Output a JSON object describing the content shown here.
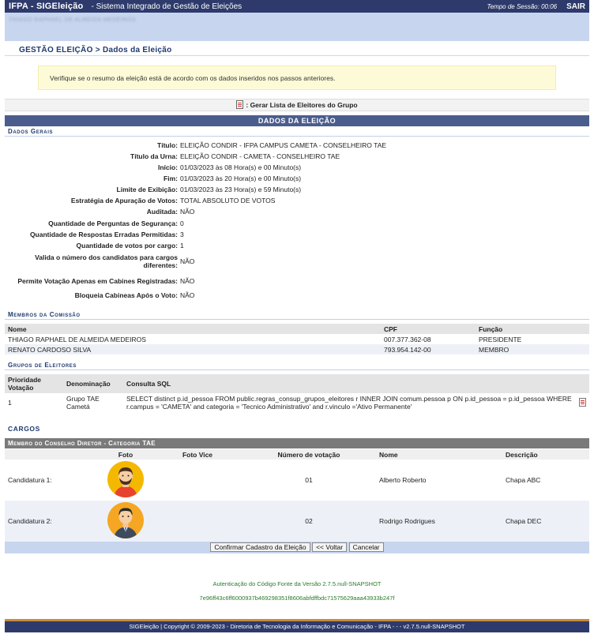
{
  "topbar": {
    "brand": "IFPA - SIGEleição",
    "subtitle": "- Sistema Integrado de Gestão de Eleições",
    "session": "Tempo de Sessão: 00:06",
    "logout": "SAIR"
  },
  "userbar": {
    "user_blurred": "THIAGO RAPHAEL DE ALMEIDA MEDEIROS"
  },
  "breadcrumb": "GESTÃO ELEIÇÃO > Dados da Eleição",
  "notice": "Verifique se o resumo da eleição está de acordo com os dados inseridos nos passos anteriores.",
  "gerar_lista": ": Gerar Lista de Eleitores do Grupo",
  "section_title": "DADOS DA ELEIÇÃO",
  "dados_gerais": {
    "heading": "Dados Gerais",
    "fields": [
      {
        "label": "Título:",
        "value": "ELEIÇÃO CONDIR - IFPA CAMPUS CAMETA - CONSELHEIRO TAE"
      },
      {
        "label": "Título da Urna:",
        "value": "ELEIÇÃO CONDIR - CAMETA - CONSELHEIRO TAE"
      },
      {
        "label": "Início:",
        "value": "01/03/2023 às 08 Hora(s) e 00 Minuto(s)"
      },
      {
        "label": "Fim:",
        "value": "01/03/2023 às 20 Hora(s) e 00 Minuto(s)"
      },
      {
        "label": "Limite de Exibição:",
        "value": "01/03/2023 às 23 Hora(s) e 59 Minuto(s)"
      },
      {
        "label": "Estratégia de Apuração de Votos:",
        "value": "TOTAL ABSOLUTO DE VOTOS"
      },
      {
        "label": "Auditada:",
        "value": "NÃO"
      },
      {
        "label": "Quantidade de Perguntas de Segurança:",
        "value": "0"
      },
      {
        "label": "Quantidade de Respostas Erradas Permitidas:",
        "value": "3"
      },
      {
        "label": "Quantidade de votos por cargo:",
        "value": "1"
      },
      {
        "label": "Valida o número dos candidatos para cargos diferentes:",
        "value": "NÃO"
      },
      {
        "label": "Permite Votação Apenas em Cabines Registradas:",
        "value": "NÃO"
      },
      {
        "label": "Bloqueia Cabineas Após o Voto:",
        "value": "NÃO"
      }
    ]
  },
  "comissao": {
    "heading": "Membros da Comissão",
    "columns": [
      "Nome",
      "CPF",
      "Função"
    ],
    "rows": [
      {
        "nome": "THIAGO RAPHAEL DE ALMEIDA MEDEIROS",
        "cpf": "007.377.362-08",
        "funcao": "PRESIDENTE"
      },
      {
        "nome": "RENATO CARDOSO SILVA",
        "cpf": "793.954.142-00",
        "funcao": "MEMBRO"
      }
    ]
  },
  "grupos": {
    "heading": "Grupos de Eleitores",
    "columns": [
      "Prioridade Votação",
      "Denominação",
      "Consulta SQL"
    ],
    "rows": [
      {
        "prioridade": "1",
        "denominacao": "Grupo TAE Cametá",
        "sql": "SELECT distinct p.id_pessoa FROM public.regras_consup_grupos_eleitores r INNER JOIN comum.pessoa p ON p.id_pessoa = p.id_pessoa WHERE r.campus = 'CAMETA' and categoria = 'Tecnico Administrativo' and r.vinculo ='Ativo Permanente'"
      }
    ]
  },
  "cargos": {
    "heading": "CARGOS",
    "cargo_title": "Membro do Conselho Diretor - Categoria TAE",
    "columns": [
      "Foto",
      "Foto Vice",
      "Número de votação",
      "Nome",
      "Descrição"
    ],
    "rows": [
      {
        "label": "Candidatura 1:",
        "numero": "01",
        "nome": "Alberto Roberto",
        "descricao": "Chapa ABC"
      },
      {
        "label": "Candidatura 2:",
        "numero": "02",
        "nome": "Rodrigo Rodrigues",
        "descricao": "Chapa DEC"
      }
    ]
  },
  "buttons": {
    "confirmar": "Confirmar Cadastro da Eleição",
    "voltar": "<< Voltar",
    "cancelar": "Cancelar"
  },
  "auth": {
    "line1": "Autenticação do Código Fonte da Versão 2.7.5.null-SNAPSHOT",
    "line2": "7e96ff43c6ff6000937b469298351f8606abfdffbdc71575629aaa43933b247f"
  },
  "footer": "SIGEleição | Copyright © 2009-2023 - Diretoria de Tecnologia da Informação e Comunicação - IFPA - - - v2.7.5.null-SNAPSHOT",
  "colors": {
    "topbar": "#2d3a6b",
    "userbar": "#c8d5ef",
    "section": "#4a5d8c",
    "cargo_head": "#7a7a7a",
    "avatar_bg": "#f5b800"
  }
}
